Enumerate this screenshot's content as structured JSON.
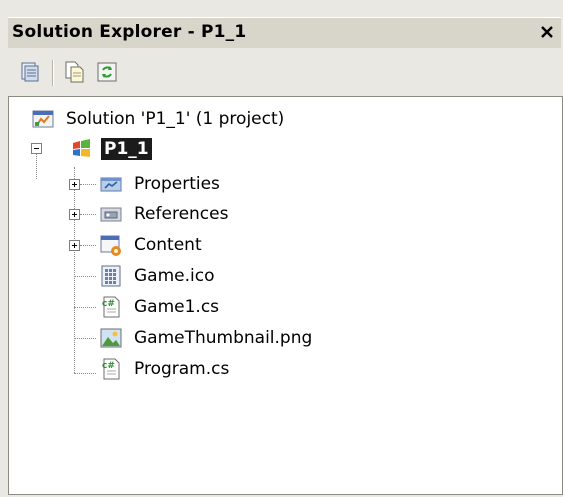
{
  "panel": {
    "title": "Solution Explorer - P1_1",
    "close_icon": "close-icon"
  },
  "toolbar": {
    "buttons": [
      {
        "name": "properties-icon"
      },
      {
        "name": "show-all-files-icon"
      },
      {
        "name": "refresh-icon"
      }
    ]
  },
  "tree": {
    "solution": {
      "label": "Solution 'P1_1' (1 project)",
      "icon": "solution-icon"
    },
    "project": {
      "label": "P1_1",
      "icon": "xna-project-icon",
      "expanded": true,
      "selected": true
    },
    "items": [
      {
        "label": "Properties",
        "icon": "properties-folder-icon",
        "expandable": true
      },
      {
        "label": "References",
        "icon": "references-folder-icon",
        "expandable": true
      },
      {
        "label": "Content",
        "icon": "content-project-icon",
        "expandable": true
      },
      {
        "label": "Game.ico",
        "icon": "ico-file-icon",
        "expandable": false
      },
      {
        "label": "Game1.cs",
        "icon": "csharp-file-icon",
        "expandable": false
      },
      {
        "label": "GameThumbnail.png",
        "icon": "image-file-icon",
        "expandable": false
      },
      {
        "label": "Program.cs",
        "icon": "csharp-file-icon",
        "expandable": false
      }
    ]
  }
}
